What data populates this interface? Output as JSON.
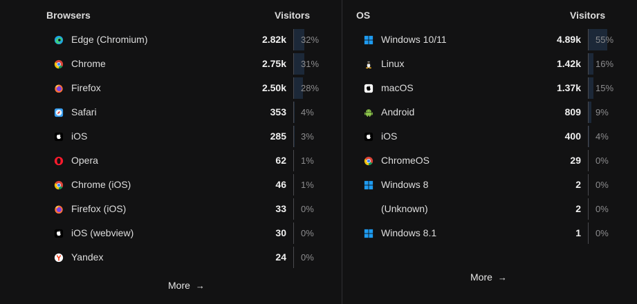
{
  "browsers": {
    "header": "Browsers",
    "visitors_header": "Visitors",
    "more_label": "More",
    "rows": [
      {
        "name": "Edge (Chromium)",
        "value": "2.82k",
        "pct": "32%",
        "share": 0.32,
        "icon": "edge-icon"
      },
      {
        "name": "Chrome",
        "value": "2.75k",
        "pct": "31%",
        "share": 0.31,
        "icon": "chrome-icon"
      },
      {
        "name": "Firefox",
        "value": "2.50k",
        "pct": "28%",
        "share": 0.28,
        "icon": "firefox-icon"
      },
      {
        "name": "Safari",
        "value": "353",
        "pct": "4%",
        "share": 0.04,
        "icon": "safari-icon"
      },
      {
        "name": "iOS",
        "value": "285",
        "pct": "3%",
        "share": 0.03,
        "icon": "apple-icon"
      },
      {
        "name": "Opera",
        "value": "62",
        "pct": "1%",
        "share": 0.01,
        "icon": "opera-icon"
      },
      {
        "name": "Chrome (iOS)",
        "value": "46",
        "pct": "1%",
        "share": 0.01,
        "icon": "chrome-icon"
      },
      {
        "name": "Firefox (iOS)",
        "value": "33",
        "pct": "0%",
        "share": 0,
        "icon": "firefox-icon"
      },
      {
        "name": "iOS (webview)",
        "value": "30",
        "pct": "0%",
        "share": 0,
        "icon": "apple-icon"
      },
      {
        "name": "Yandex",
        "value": "24",
        "pct": "0%",
        "share": 0,
        "icon": "yandex-icon"
      }
    ]
  },
  "os": {
    "header": "OS",
    "visitors_header": "Visitors",
    "more_label": "More",
    "rows": [
      {
        "name": "Windows 10/11",
        "value": "4.89k",
        "pct": "55%",
        "share": 0.55,
        "icon": "windows-icon"
      },
      {
        "name": "Linux",
        "value": "1.42k",
        "pct": "16%",
        "share": 0.16,
        "icon": "linux-icon"
      },
      {
        "name": "macOS",
        "value": "1.37k",
        "pct": "15%",
        "share": 0.15,
        "icon": "macos-icon"
      },
      {
        "name": "Android",
        "value": "809",
        "pct": "9%",
        "share": 0.09,
        "icon": "android-icon"
      },
      {
        "name": "iOS",
        "value": "400",
        "pct": "4%",
        "share": 0.04,
        "icon": "apple-icon"
      },
      {
        "name": "ChromeOS",
        "value": "29",
        "pct": "0%",
        "share": 0,
        "icon": "chrome-icon"
      },
      {
        "name": "Windows 8",
        "value": "2",
        "pct": "0%",
        "share": 0,
        "icon": "windows-icon"
      },
      {
        "name": "(Unknown)",
        "value": "2",
        "pct": "0%",
        "share": 0,
        "icon": ""
      },
      {
        "name": "Windows 8.1",
        "value": "1",
        "pct": "0%",
        "share": 0,
        "icon": "windows-icon"
      }
    ]
  },
  "colors": {
    "background": "#121213",
    "bar": "#1c2838",
    "separator": "#4a4a4e",
    "windows_blue": "#1e9bf0"
  }
}
